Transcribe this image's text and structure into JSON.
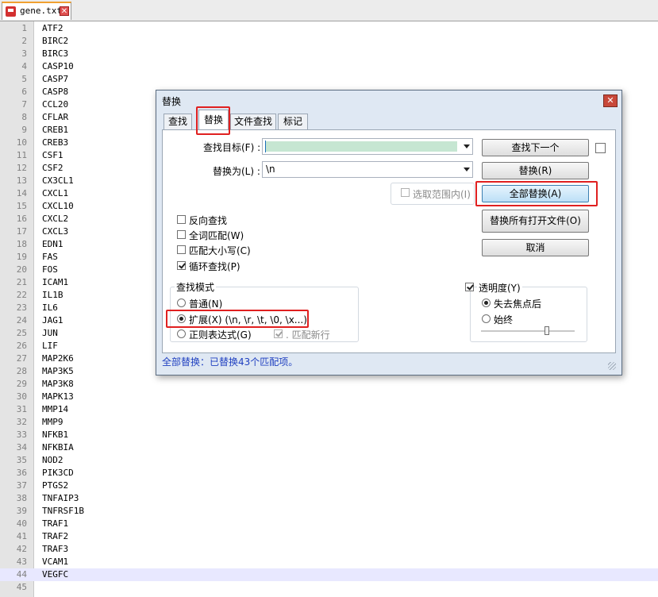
{
  "tab": {
    "filename": "gene.txt",
    "close_glyph": "✕"
  },
  "editor": {
    "lines": [
      {
        "n": "1",
        "text": "ATF2"
      },
      {
        "n": "2",
        "text": "BIRC2"
      },
      {
        "n": "3",
        "text": "BIRC3"
      },
      {
        "n": "4",
        "text": "CASP10"
      },
      {
        "n": "5",
        "text": "CASP7"
      },
      {
        "n": "6",
        "text": "CASP8"
      },
      {
        "n": "7",
        "text": "CCL20"
      },
      {
        "n": "8",
        "text": "CFLAR"
      },
      {
        "n": "9",
        "text": "CREB1"
      },
      {
        "n": "10",
        "text": "CREB3"
      },
      {
        "n": "11",
        "text": "CSF1"
      },
      {
        "n": "12",
        "text": "CSF2"
      },
      {
        "n": "13",
        "text": "CX3CL1"
      },
      {
        "n": "14",
        "text": "CXCL1"
      },
      {
        "n": "15",
        "text": "CXCL10"
      },
      {
        "n": "16",
        "text": "CXCL2"
      },
      {
        "n": "17",
        "text": "CXCL3"
      },
      {
        "n": "18",
        "text": "EDN1"
      },
      {
        "n": "19",
        "text": "FAS"
      },
      {
        "n": "20",
        "text": "FOS"
      },
      {
        "n": "21",
        "text": "ICAM1"
      },
      {
        "n": "22",
        "text": "IL1B"
      },
      {
        "n": "23",
        "text": "IL6"
      },
      {
        "n": "24",
        "text": "JAG1"
      },
      {
        "n": "25",
        "text": "JUN"
      },
      {
        "n": "26",
        "text": "LIF"
      },
      {
        "n": "27",
        "text": "MAP2K6"
      },
      {
        "n": "28",
        "text": "MAP3K5"
      },
      {
        "n": "29",
        "text": "MAP3K8"
      },
      {
        "n": "30",
        "text": "MAPK13"
      },
      {
        "n": "31",
        "text": "MMP14"
      },
      {
        "n": "32",
        "text": "MMP9"
      },
      {
        "n": "33",
        "text": "NFKB1"
      },
      {
        "n": "34",
        "text": "NFKBIA"
      },
      {
        "n": "35",
        "text": "NOD2"
      },
      {
        "n": "36",
        "text": "PIK3CD"
      },
      {
        "n": "37",
        "text": "PTGS2"
      },
      {
        "n": "38",
        "text": "TNFAIP3"
      },
      {
        "n": "39",
        "text": "TNFRSF1B"
      },
      {
        "n": "40",
        "text": "TRAF1"
      },
      {
        "n": "41",
        "text": "TRAF2"
      },
      {
        "n": "42",
        "text": "TRAF3"
      },
      {
        "n": "43",
        "text": "VCAM1"
      },
      {
        "n": "44",
        "text": "VEGFC"
      },
      {
        "n": "45",
        "text": ""
      }
    ],
    "current_line": 44
  },
  "dialog": {
    "title": "替换",
    "close_glyph": "✕",
    "tabs": [
      "查找",
      "替换",
      "文件查找",
      "标记"
    ],
    "active_tab": "替换",
    "find_label": "查找目标(F) :",
    "find_value": "",
    "replace_label": "替换为(L) :",
    "replace_value": "\\n",
    "in_selection": "选取范围内(I)",
    "buttons": {
      "find_next": "查找下一个",
      "replace": "替换(R)",
      "replace_all": "全部替换(A)",
      "replace_all_open": "替换所有打开文件(O)",
      "cancel": "取消"
    },
    "options": {
      "reverse": "反向查找",
      "whole_word": "全词匹配(W)",
      "match_case": "匹配大小写(C)",
      "wrap": "循环查找(P)"
    },
    "search_mode": {
      "title": "查找模式",
      "normal": "普通(N)",
      "extended": "扩展(X) (\\n, \\r, \\t, \\0, \\x...)",
      "regex": "正则表达式(G)",
      "dot_newline": ". 匹配新行",
      "selected": "extended"
    },
    "transparency": {
      "label": "透明度(Y)",
      "on_lose_focus": "失去焦点后",
      "always": "始终",
      "level": 0.7
    },
    "status": "全部替换：已替换43个匹配项。"
  },
  "colors": {
    "highlight": "#e02020",
    "status_text": "#1f3fc0",
    "find_selection": "#c6e6d2"
  }
}
